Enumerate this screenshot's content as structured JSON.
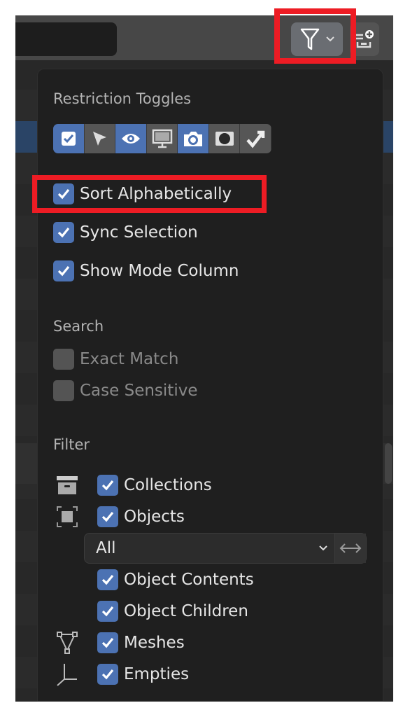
{
  "header": {
    "filter_button": "filter-icon",
    "add_button": "new-collection-icon"
  },
  "popup": {
    "restriction_title": "Restriction Toggles",
    "restriction_toggles": [
      {
        "icon": "checkbox-icon",
        "active": true
      },
      {
        "icon": "cursor-arrow-icon",
        "active": false
      },
      {
        "icon": "eye-icon",
        "active": true
      },
      {
        "icon": "monitor-icon",
        "active": false
      },
      {
        "icon": "camera-icon",
        "active": true
      },
      {
        "icon": "holdout-icon",
        "active": false
      },
      {
        "icon": "indirect-only-icon",
        "active": false
      }
    ],
    "options": [
      {
        "label": "Sort Alphabetically",
        "checked": true
      },
      {
        "label": "Sync Selection",
        "checked": true
      },
      {
        "label": "Show Mode Column",
        "checked": true
      }
    ],
    "search_title": "Search",
    "search_options": [
      {
        "label": "Exact Match",
        "checked": false
      },
      {
        "label": "Case Sensitive",
        "checked": false
      }
    ],
    "filter_title": "Filter",
    "filter_items": [
      {
        "label": "Collections",
        "checked": true,
        "icon": "collection-icon"
      },
      {
        "label": "Objects",
        "checked": true,
        "icon": "object-icon"
      }
    ],
    "object_filter_select": "All",
    "object_items": [
      {
        "label": "Object Contents",
        "checked": true
      },
      {
        "label": "Object Children",
        "checked": true
      }
    ],
    "type_items": [
      {
        "label": "Meshes",
        "checked": true,
        "icon": "mesh-icon"
      },
      {
        "label": "Empties",
        "checked": true,
        "icon": "empty-icon"
      }
    ]
  },
  "colors": {
    "accent": "#4c72b3",
    "highlight": "#ed1c24",
    "selected_row": "#2a4466"
  }
}
